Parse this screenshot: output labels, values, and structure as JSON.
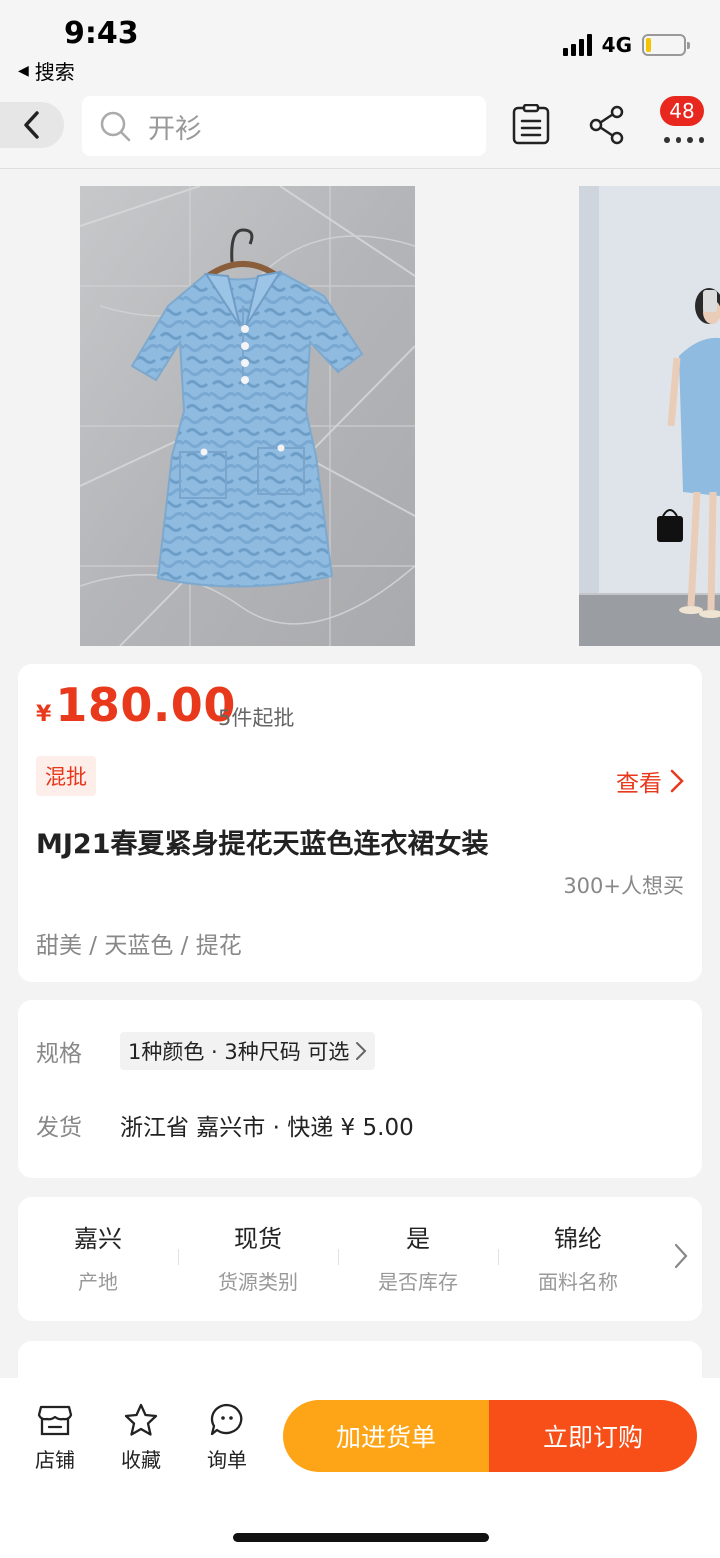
{
  "status_bar": {
    "time": "9:43",
    "back_app": "搜索",
    "network": "4G",
    "battery_level": 0.15
  },
  "nav": {
    "search_text": "开衫",
    "cart_count": "48"
  },
  "product": {
    "currency": "¥",
    "price": "180.00",
    "min_order": "5件起批",
    "tag": "混批",
    "view_more": "查看",
    "title": "MJ21春夏紧身提花天蓝色连衣裙女装",
    "wants": "300+人想买",
    "attributes": "甜美 / 天蓝色 / 提花"
  },
  "specs": {
    "spec_label": "规格",
    "spec_value": "1种颜色 · 3种尺码 可选",
    "ship_label": "发货",
    "ship_value": "浙江省 嘉兴市  ·  快递 ¥ 5.00"
  },
  "attr_table": [
    {
      "value": "嘉兴",
      "key": "产地"
    },
    {
      "value": "现货",
      "key": "货源类别"
    },
    {
      "value": "是",
      "key": "是否库存"
    },
    {
      "value": "锦纶",
      "key": "面料名称"
    }
  ],
  "bottom_bar": {
    "store": "店铺",
    "favorite": "收藏",
    "inquiry": "询单",
    "add_cart": "加进货单",
    "buy_now": "立即订购"
  },
  "colors": {
    "price_red": "#e8391d",
    "cart_orange": "#fda417",
    "buy_orange": "#f74f17",
    "dress_blue": "#8fb8d8"
  }
}
